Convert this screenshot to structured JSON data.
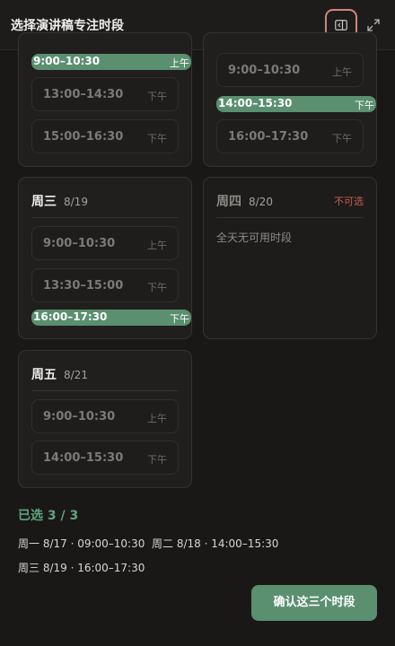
{
  "header": {
    "title": "选择演讲稿专注时段",
    "sidebar_icon": "sidebar-toggle-icon",
    "expand_icon": "expand-icon"
  },
  "days": {
    "mon": {
      "slots": [
        {
          "time": "9:00–10:30",
          "period": "上午",
          "selected": true
        },
        {
          "time": "13:00–14:30",
          "period": "下午"
        },
        {
          "time": "15:00–16:30",
          "period": "下午"
        }
      ]
    },
    "tue": {
      "slots": [
        {
          "time": "9:00–10:30",
          "period": "上午"
        },
        {
          "time": "14:00–15:30",
          "period": "下午",
          "selected": true
        },
        {
          "time": "16:00–17:30",
          "period": "下午"
        }
      ]
    },
    "wed": {
      "day": "周三",
      "date": "8/19",
      "slots": [
        {
          "time": "9:00–10:30",
          "period": "上午"
        },
        {
          "time": "13:30–15:00",
          "period": "下午"
        },
        {
          "time": "16:00–17:30",
          "period": "下午",
          "selected": true
        }
      ]
    },
    "thu": {
      "day": "周四",
      "date": "8/20",
      "badge": "不可选",
      "notice": "全天无可用时段"
    },
    "fri": {
      "day": "周五",
      "date": "8/21",
      "slots": [
        {
          "time": "9:00–10:30",
          "period": "上午"
        },
        {
          "time": "14:00–15:30",
          "period": "下午"
        }
      ]
    }
  },
  "summary": {
    "title": "已选 3 / 3",
    "items": [
      "周一 8/17 · 09:00–10:30",
      "周二 8/18 · 14:00–15:30",
      "周三 8/19 · 16:00–17:30"
    ]
  },
  "confirm_label": "确认这三个时段",
  "colors": {
    "accent": "#5a8f70",
    "accent_text": "#5fa67c",
    "unavailable": "#c75b4b",
    "background": "#191817"
  }
}
